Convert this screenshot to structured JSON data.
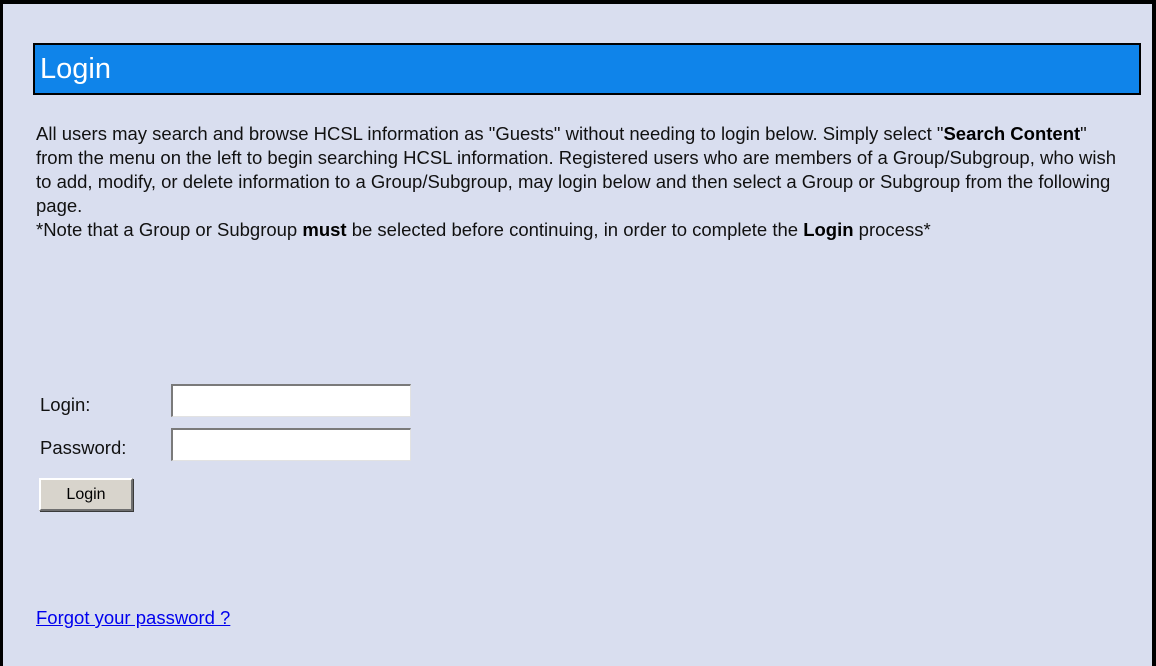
{
  "header": {
    "title": "Login"
  },
  "intro": {
    "part1": "All users may search and browse HCSL information as \"Guests\" without needing to login below. Simply select \"",
    "search_content": "Search Content",
    "part2": "\" from the menu on the left to begin searching HCSL information. Registered users who are members of a Group/Subgroup, who wish to add, modify, or delete information to a Group/Subgroup, may login below and then select a Group or Subgroup from the following page.",
    "note_part1": "*Note that a Group or Subgroup ",
    "note_must": "must",
    "note_part2": " be selected before continuing, in order to complete the ",
    "note_login": "Login",
    "note_part3": " process*"
  },
  "form": {
    "login_label": "Login:",
    "login_value": "",
    "password_label": "Password:",
    "password_value": "",
    "submit_label": "Login"
  },
  "links": {
    "forgot_password": "Forgot your password ?"
  },
  "colors": {
    "page_background": "#d9deef",
    "title_bar": "#0f84ea",
    "link": "#0000ee"
  }
}
